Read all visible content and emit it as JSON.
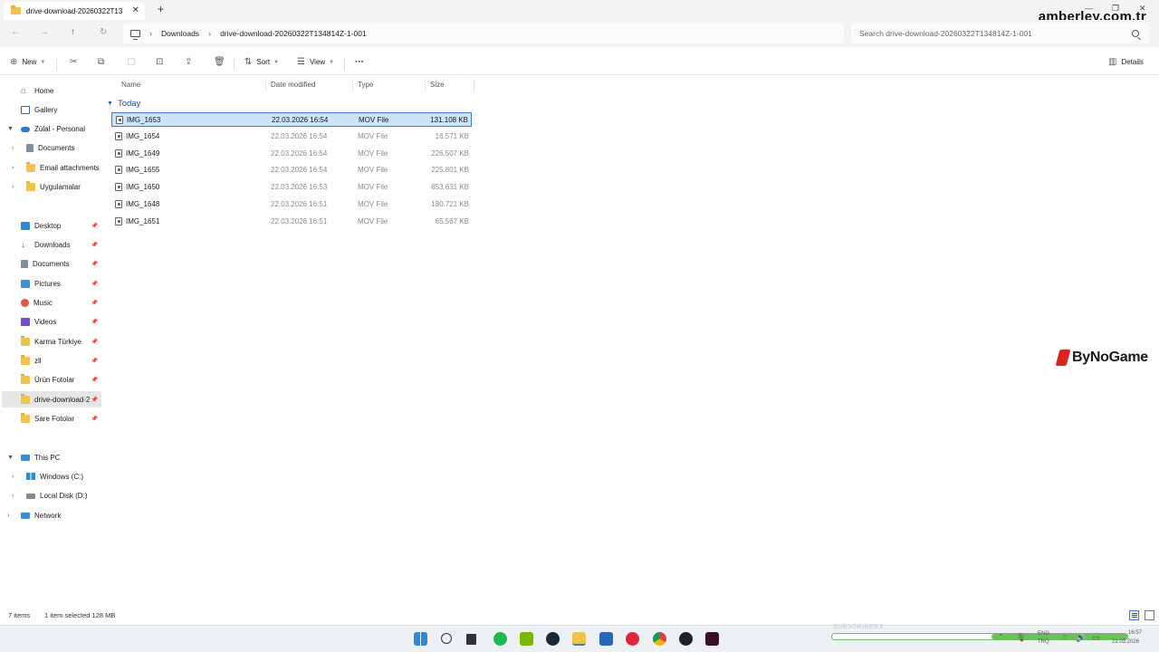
{
  "window": {
    "tab_title": "drive-download-20260322T13",
    "close_glyph": "✕",
    "new_tab_glyph": "+",
    "watermark": "amberley.com.tr"
  },
  "address": {
    "breadcrumbs": [
      "Downloads",
      "drive-download-20260322T134814Z-1-001"
    ],
    "separator": "›",
    "search_placeholder": "Search drive-download-20260322T134814Z-1-001"
  },
  "toolbar": {
    "new_label": "New",
    "sort_label": "Sort",
    "view_label": "View",
    "more_glyph": "···",
    "details_label": "Details"
  },
  "sidebar": {
    "top": [
      {
        "label": "Home",
        "icon": "home-icon"
      },
      {
        "label": "Gallery",
        "icon": "gallery-icon"
      },
      {
        "label": "Zülal - Personal",
        "icon": "cloud-icon"
      },
      {
        "label": "Documents",
        "icon": "document-icon"
      },
      {
        "label": "Email attachments",
        "icon": "folder-icon"
      },
      {
        "label": "Uygulamalar",
        "icon": "folder-icon"
      }
    ],
    "quick_access": [
      {
        "label": "Desktop",
        "icon": "desktop-icon"
      },
      {
        "label": "Downloads",
        "icon": "download-icon"
      },
      {
        "label": "Documents",
        "icon": "document-icon"
      },
      {
        "label": "Pictures",
        "icon": "pictures-icon"
      },
      {
        "label": "Music",
        "icon": "music-icon"
      },
      {
        "label": "Videos",
        "icon": "video-icon"
      },
      {
        "label": "Karma Türkiye",
        "icon": "folder-icon"
      },
      {
        "label": "zll",
        "icon": "folder-icon"
      },
      {
        "label": "Ürün Fotolar",
        "icon": "folder-icon"
      },
      {
        "label": "drive-download-2",
        "icon": "folder-icon"
      },
      {
        "label": "Sare Fotolar",
        "icon": "folder-icon"
      }
    ],
    "pc": [
      {
        "label": "This PC",
        "icon": "pc-icon"
      },
      {
        "label": "Windows (C:)",
        "icon": "windows-drive-icon"
      },
      {
        "label": "Local Disk (D:)",
        "icon": "drive-icon"
      },
      {
        "label": "Network",
        "icon": "network-icon"
      }
    ],
    "pin_glyph": "📌"
  },
  "columns": {
    "name": "Name",
    "date": "Date modified",
    "type": "Type",
    "size": "Size"
  },
  "group_label": "Today",
  "files": [
    {
      "name": "IMG_1653",
      "date": "22.03.2026 16:54",
      "type": "MOV File",
      "size": "131.108 KB"
    },
    {
      "name": "IMG_1654",
      "date": "22.03.2026 16:54",
      "type": "MOV File",
      "size": "16.571 KB"
    },
    {
      "name": "IMG_1649",
      "date": "22.03.2026 16:54",
      "type": "MOV File",
      "size": "226.507 KB"
    },
    {
      "name": "IMG_1655",
      "date": "22.03.2026 16:54",
      "type": "MOV File",
      "size": "225.801 KB"
    },
    {
      "name": "IMG_1650",
      "date": "22.03.2026 16:53",
      "type": "MOV File",
      "size": "853.631 KB"
    },
    {
      "name": "IMG_1648",
      "date": "22.03.2026 16:51",
      "type": "MOV File",
      "size": "180.721 KB"
    },
    {
      "name": "IMG_1651",
      "date": "22.03.2026 16:51",
      "type": "MOV File",
      "size": "65.567 KB"
    }
  ],
  "status": {
    "items": "7 items",
    "selected": "1 item selected  128 MB"
  },
  "logo_text": "ByNoGame",
  "taskbar": {
    "language": "ENG",
    "region": "TRQ",
    "time": "16:57",
    "date": "22.03.2026",
    "subscribers_label": "SUBSCRIBERS",
    "subscribers_progress": 0.54
  },
  "colors": {
    "selection": "#cce4f7",
    "accent": "#3a7bd5",
    "logo_red": "#d9261c",
    "progress_green": "#6cbf5f"
  }
}
